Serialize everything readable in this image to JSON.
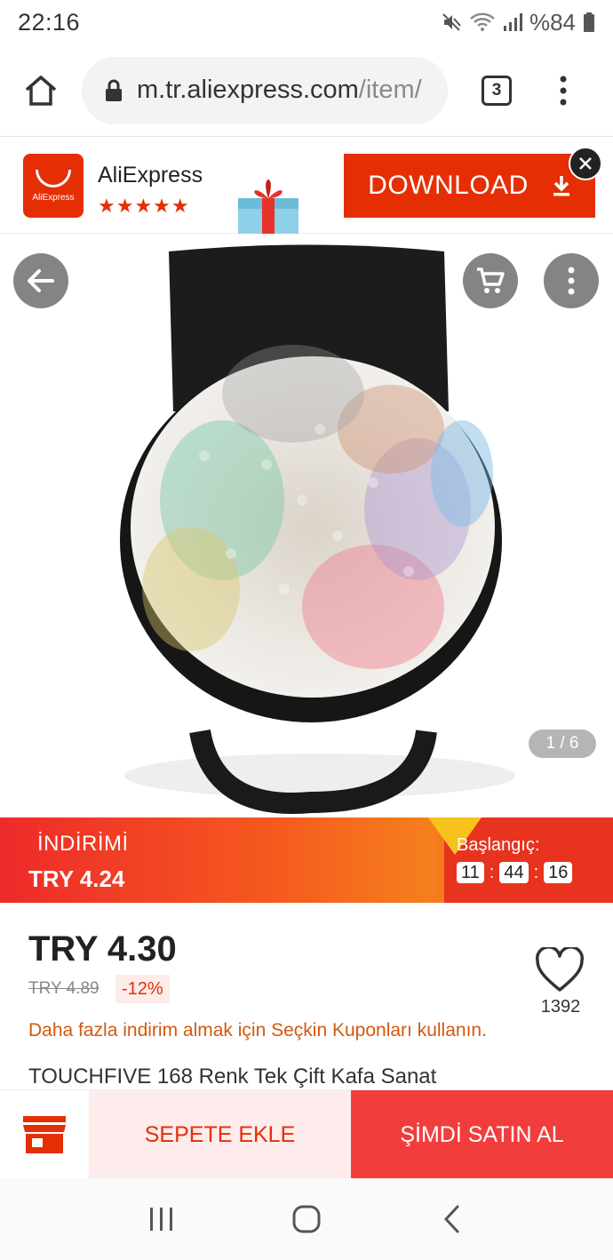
{
  "status_bar": {
    "time": "22:16",
    "battery": "%84"
  },
  "browser": {
    "url_main": "m.tr.aliexpress.com",
    "url_rest": "/item/",
    "tab_count": "3"
  },
  "app_banner": {
    "logo_label": "AliExpress",
    "app_name": "AliExpress",
    "stars": "★★★★★",
    "download_label": "DOWNLOAD"
  },
  "gallery": {
    "counter": "1 / 6"
  },
  "promo": {
    "label": "İNDİRİMİ",
    "price": "TRY 4.24",
    "start_label": "Başlangıç:",
    "hours": "11",
    "minutes": "44",
    "seconds": "16"
  },
  "product": {
    "price": "TRY 4.30",
    "old_price": "TRY 4.89",
    "discount": "-12%",
    "wishlist_count": "1392",
    "coupon_note": "Daha fazla indirim almak için Seçkin Kuponları kullanın.",
    "title": "TOUCHFIVE 168 Renk Tek Çift Kafa Sanat"
  },
  "actions": {
    "add_to_cart": "SEPETE EKLE",
    "buy_now": "ŞİMDİ SATIN AL"
  },
  "colors": {
    "brand_red": "#e62e04",
    "buy_red": "#f23d3d",
    "promo_orange": "#f57f1d",
    "coupon_orange": "#d5580e"
  },
  "icons": [
    "mute-icon",
    "wifi-icon",
    "signal-icon",
    "battery-icon",
    "home-icon",
    "lock-icon",
    "more-vertical-icon",
    "gift-icon",
    "download-icon",
    "close-icon",
    "back-arrow-icon",
    "cart-icon",
    "heart-icon",
    "store-icon",
    "recents-icon",
    "home-circle-icon",
    "nav-back-icon"
  ]
}
